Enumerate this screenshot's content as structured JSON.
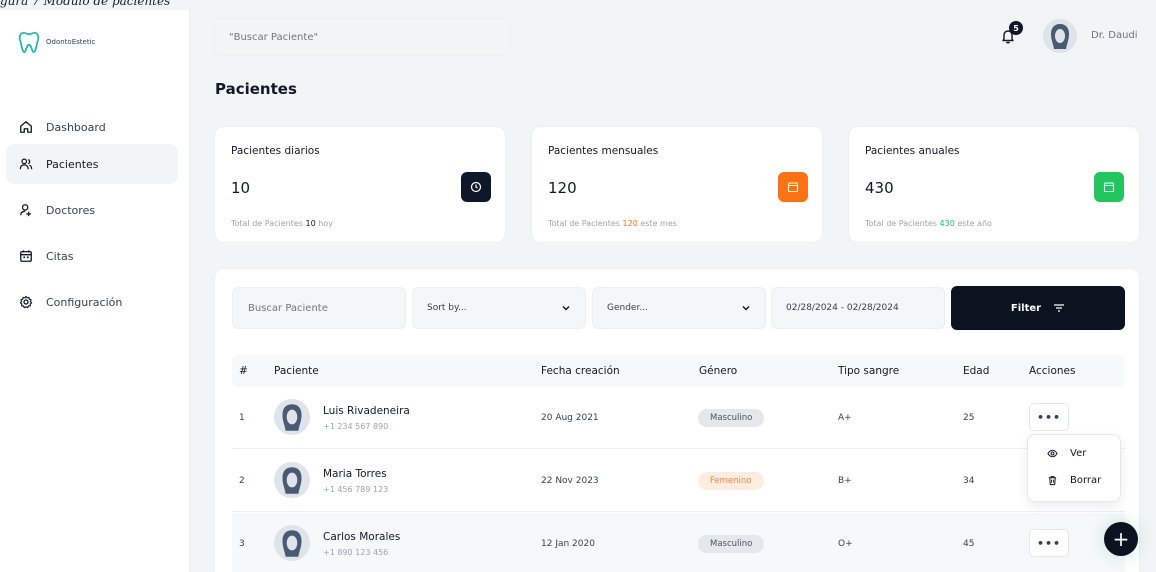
{
  "caption": "gura 7 Modulo de pacientes",
  "brand": {
    "name": "OdontoEstetic",
    "icon": "tooth-icon"
  },
  "sidebar": {
    "items": [
      {
        "label": "Dashboard",
        "icon": "home-icon",
        "active": false
      },
      {
        "label": "Pacientes",
        "icon": "users-icon",
        "active": true
      },
      {
        "label": "Doctores",
        "icon": "doctor-icon",
        "active": false
      },
      {
        "label": "Citas",
        "icon": "calendar-icon",
        "active": false
      },
      {
        "label": "Configuración",
        "icon": "gear-icon",
        "active": false
      }
    ]
  },
  "topbar": {
    "search_placeholder": "\"Buscar Paciente\"",
    "notifications_count": "5",
    "user_name": "Dr. Daudi"
  },
  "page": {
    "title": "Pacientes"
  },
  "stats": [
    {
      "label": "Pacientes diarios",
      "value": "10",
      "foot_prefix": "Total de Pacientes ",
      "foot_value": "10",
      "foot_suffix": " hoy",
      "accent": "#0f172a",
      "icon": "clock-icon"
    },
    {
      "label": "Pacientes mensuales",
      "value": "120",
      "foot_prefix": "Total de Pacientes ",
      "foot_value": "120",
      "foot_suffix": " este mes",
      "accent": "#f97316",
      "icon": "calendar-month-icon"
    },
    {
      "label": "Pacientes anuales",
      "value": "430",
      "foot_prefix": "Total de Pacientes ",
      "foot_value": "430",
      "foot_suffix": " este año",
      "accent": "#22c55e",
      "icon": "calendar-year-icon"
    }
  ],
  "filters": {
    "search_placeholder": "Buscar Paciente",
    "sort_label": "Sort by...",
    "gender_label": "Gender...",
    "date_range": "02/28/2024 - 02/28/2024",
    "filter_button": "Filter"
  },
  "table": {
    "headers": [
      "#",
      "Paciente",
      "Fecha creación",
      "Género",
      "Tipo sangre",
      "Edad",
      "Acciones"
    ],
    "rows": [
      {
        "num": "1",
        "name": "Luis Rivadeneira",
        "phone": "+1 234 567 890",
        "date": "20 Aug 2021",
        "gender": "Masculino",
        "blood": "A+",
        "age": "25"
      },
      {
        "num": "2",
        "name": "Maria Torres",
        "phone": "+1 456 789 123",
        "date": "22 Nov 2023",
        "gender": "Femenino",
        "blood": "B+",
        "age": "34"
      },
      {
        "num": "3",
        "name": "Carlos Morales",
        "phone": "+1 890 123 456",
        "date": "12 Jan 2020",
        "gender": "Masculino",
        "blood": "O+",
        "age": "45"
      }
    ],
    "actions_label": "•••"
  },
  "row_menu": {
    "view": "Ver",
    "delete": "Borrar"
  },
  "fab_label": "+"
}
